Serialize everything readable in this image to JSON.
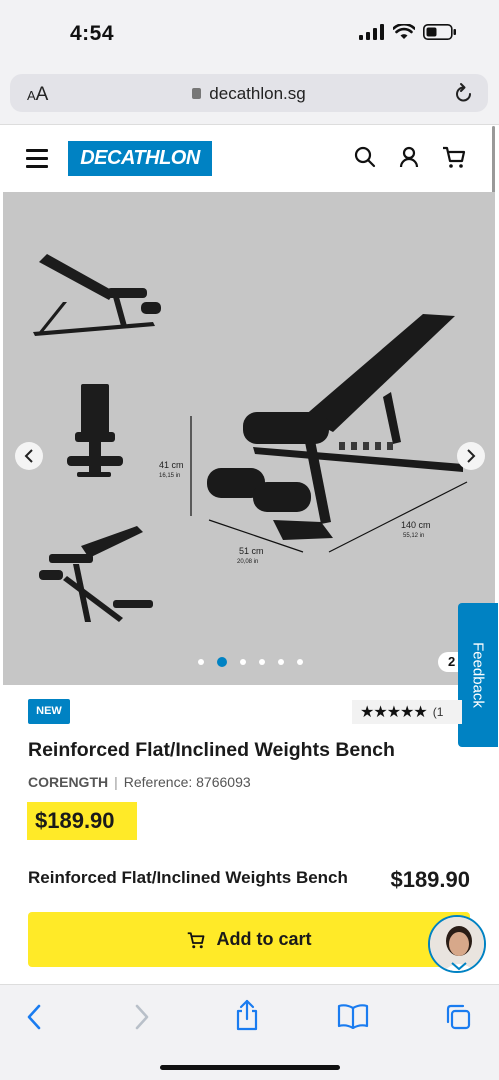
{
  "status": {
    "time": "4:54"
  },
  "browser": {
    "aa_small": "A",
    "aa_large": "A",
    "url": "decathlon.sg"
  },
  "header": {
    "logo": "DECATHLON"
  },
  "gallery": {
    "counter": "2",
    "dots_total": 6,
    "active_dot": 2,
    "dimensions": {
      "height_cm": "41 cm",
      "height_in": "16,15 in",
      "width_cm": "51 cm",
      "width_in": "20,08 in",
      "length_cm": "140 cm",
      "length_in": "55,12 in"
    }
  },
  "feedback": "Feedback",
  "product": {
    "badge": "NEW",
    "stars": "★★★★★",
    "rating_count": "(1",
    "title": "Reinforced Flat/Inclined Weights Bench",
    "brand": "CORENGTH",
    "separator": "|",
    "reference": "Reference: 8766093",
    "price": "$189.90"
  },
  "sticky": {
    "name": "Reinforced Flat/Inclined Weights Bench",
    "price": "$189.90",
    "add_to_cart": "Add to cart"
  },
  "colors": {
    "brand_blue": "#0082c3",
    "price_yellow": "#ffea28"
  }
}
